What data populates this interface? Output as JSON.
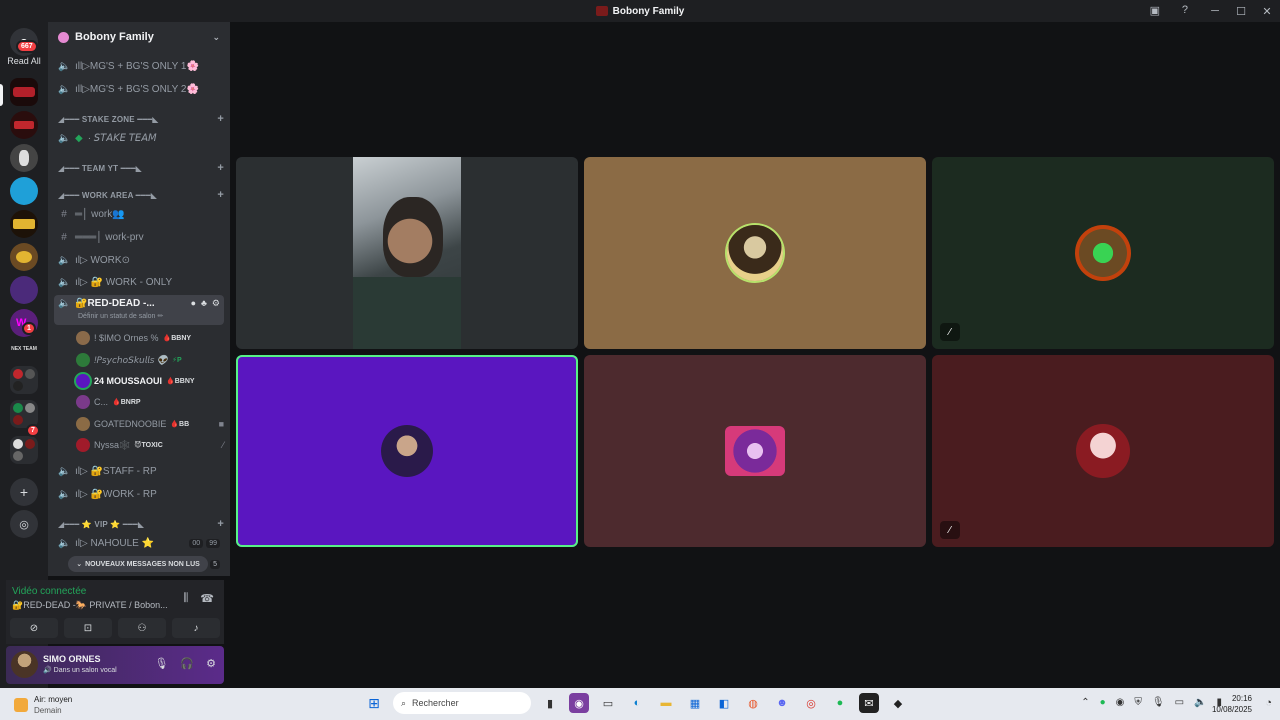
{
  "window": {
    "title": "Bobony Family"
  },
  "rail": {
    "dm_badge": "667",
    "read_all": "Read All",
    "badge_w": "1",
    "badge_p": "7"
  },
  "guild": {
    "name": "Bobony Family"
  },
  "channels": {
    "mg1": "ıll▷MG'S + BG'S ONLY 1🌸",
    "mg2": "ıll▷MG'S + BG'S ONLY 2🌸",
    "cat_stake": "◢━━━ STAKE ZONE ━━━◣",
    "stake_team": "· 𝘚𝘛𝘈𝘒𝘌 𝘛𝘌𝘈𝘔",
    "cat_yt": "◢━━━ TEAM YT ━━━◣",
    "cat_work": "◢━━━ WORK AREA ━━━◣",
    "work": "═│ work👥",
    "work_prv": "═══│ work-prv",
    "work_o": "ıl▷ WORK⊙",
    "work_only": "ıl▷ 🔐 WORK - ONLY",
    "red_dead": "🔐RED-DEAD -...",
    "red_dead_status": "Définir un statut de salon ✏",
    "staff_rp": "ıl▷ 🔐STAFF - RP",
    "work_rp": "ıl▷ 🔐WORK - RP",
    "cat_vip": "◢━━━ ⭐ VIP ⭐ ━━━◣",
    "nahoule": "ıl▷ NAHOULE ⭐",
    "nahoule_count": "00",
    "nahoule_count2": "99",
    "hidden_count": "5"
  },
  "voice_users": [
    {
      "name": "! $IMO Ornes %",
      "tag": "🩸BBNY"
    },
    {
      "name": "!𝘗𝘴𝘺𝘤𝘩𝘰𝘚𝘬𝘶𝘭𝘭𝘴 👽",
      "tag": "⚡P"
    },
    {
      "name": "24 MOUSSAOUI",
      "tag": "🩸BBNY"
    },
    {
      "name": "C...",
      "tag": "🩸BNRP"
    },
    {
      "name": "GOATEDNOOBIE",
      "tag": "🩸BB"
    },
    {
      "name": "Nyssa🕸️",
      "tag": "😈TOXIC"
    }
  ],
  "new_messages": "NOUVEAUX MESSAGES NON LUS",
  "voice_panel": {
    "status": "Vidéo connectée",
    "channel": "🔐RED-DEAD -🐎 PRIVATE / Bobon..."
  },
  "user_panel": {
    "name": "SIMO ORNES",
    "sub": "🔊 Dans un salon vocal"
  },
  "taskbar": {
    "weather_line1": "Air: moyen",
    "weather_line2": "Demain",
    "search_placeholder": "Rechercher",
    "time": "20:16",
    "date": "10/08/2025"
  },
  "colors": {
    "tile1": "#2b2f31",
    "tile2": "#8b6b45",
    "tile3": "#1c2b20",
    "tile4": "#5a16c0",
    "tile5": "#4d2a2e",
    "tile6": "#4a1c1f",
    "speaking": "#57f287",
    "connected": "#23a55a"
  }
}
